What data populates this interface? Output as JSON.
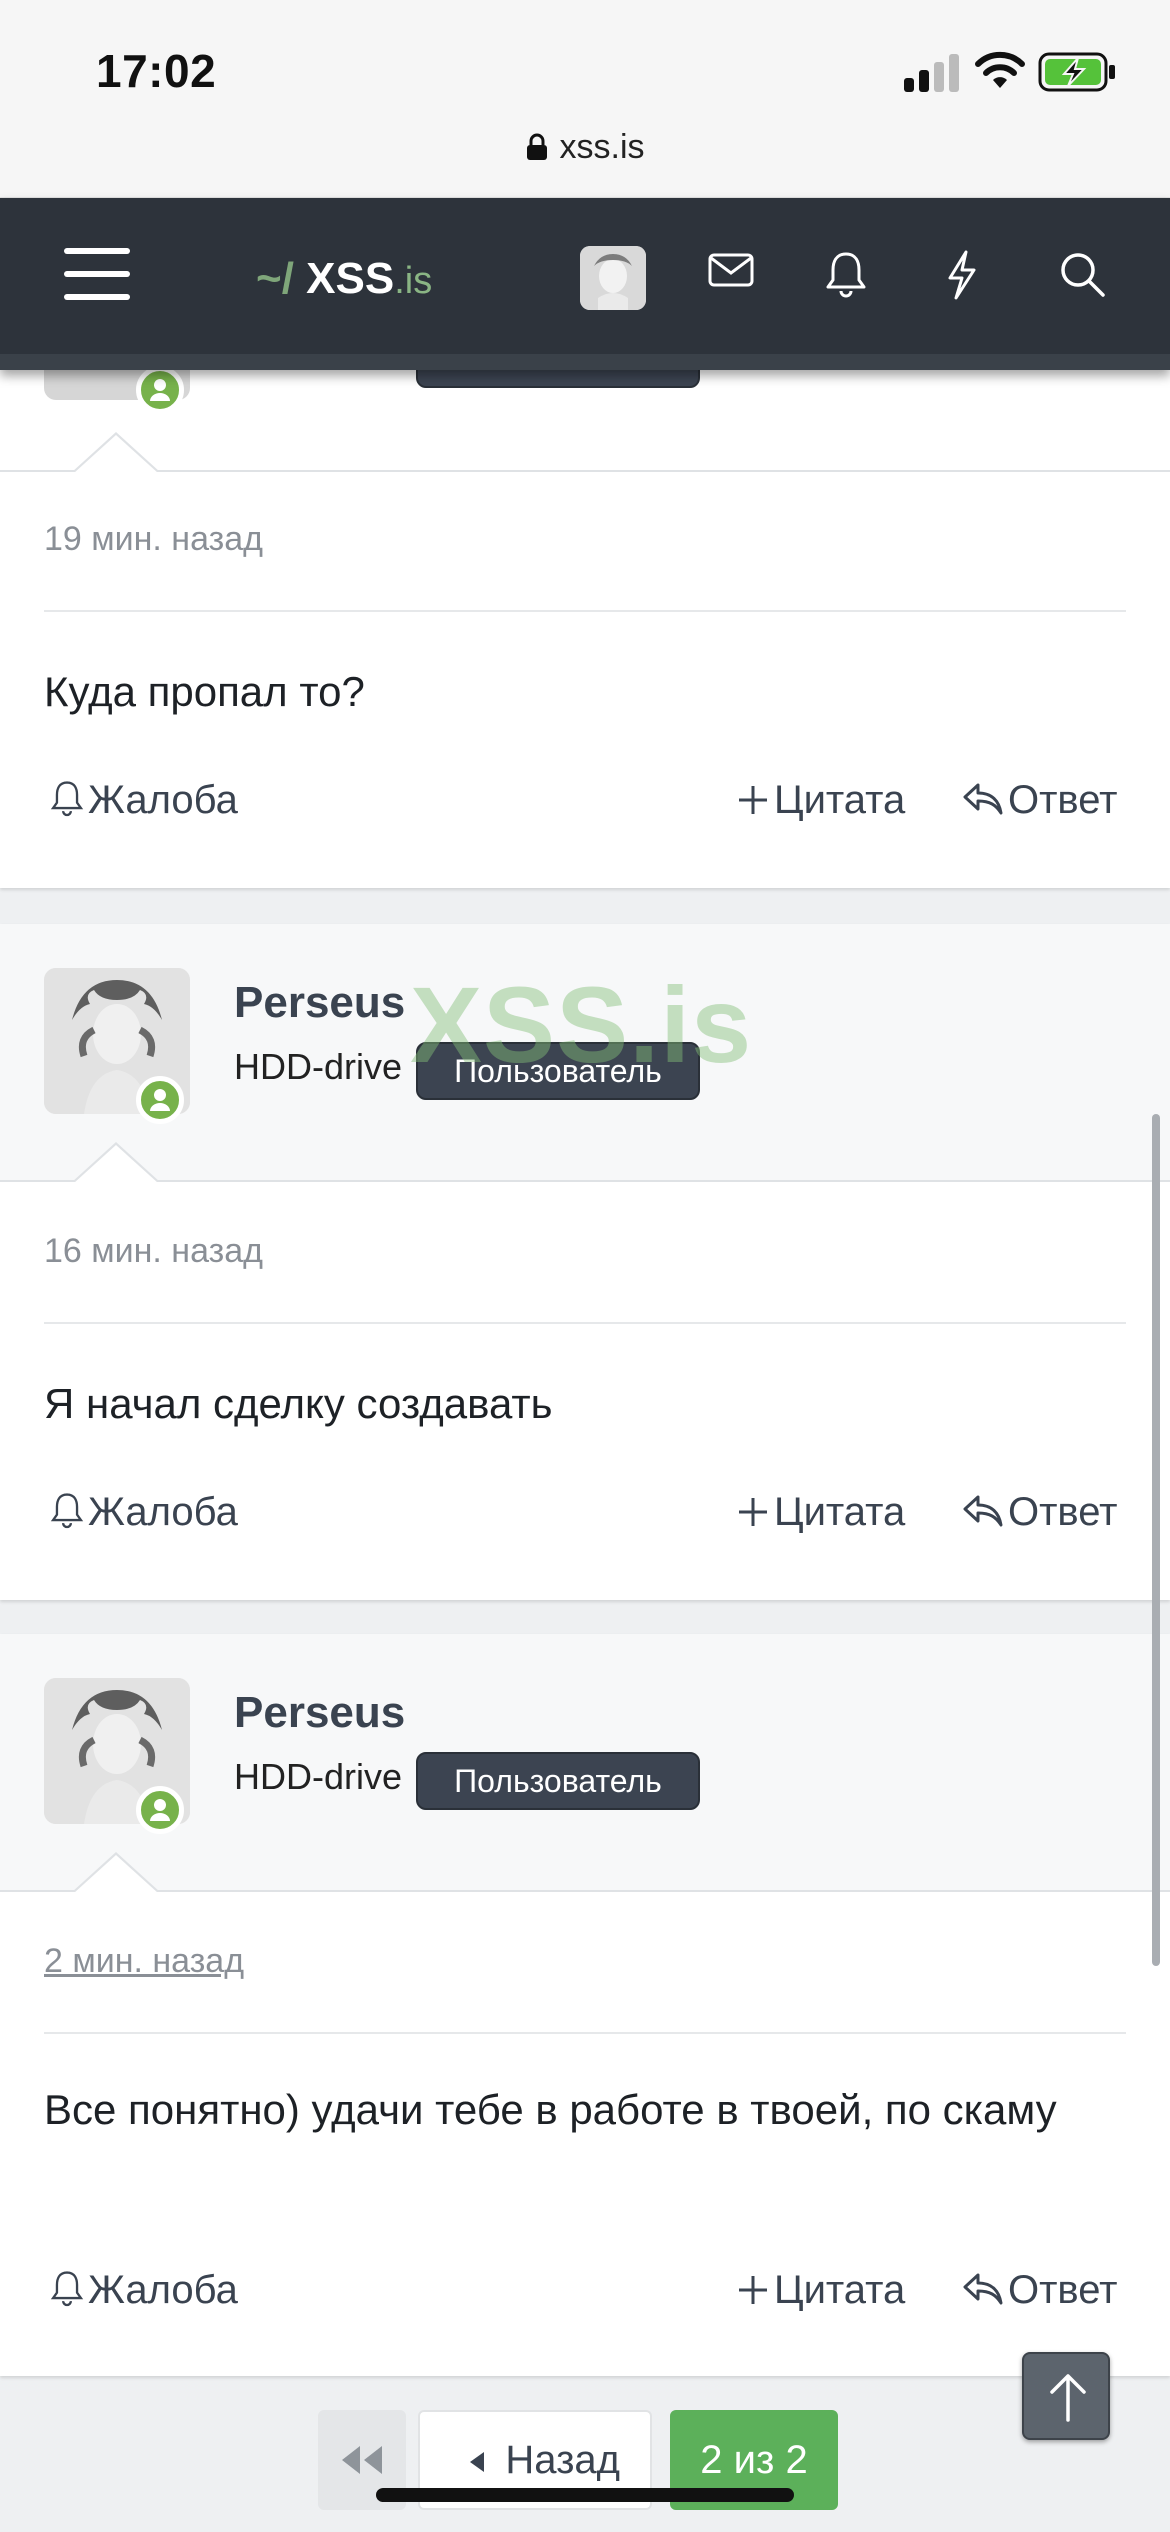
{
  "status_bar": {
    "time": "17:02",
    "url": "xss.is",
    "icons": [
      "signal-icon",
      "wifi-icon",
      "battery-charging-icon",
      "lock-icon"
    ]
  },
  "header": {
    "logo_prefix": "~/",
    "logo_main": "XSS",
    "logo_tld": ".is",
    "icons": [
      "menu-icon",
      "avatar",
      "mail-icon",
      "bell-icon",
      "lightning-icon",
      "search-icon"
    ],
    "colors": {
      "background": "#2d333b",
      "logo_accent": "#7fa67a"
    }
  },
  "watermark": "XSS.is",
  "posts": [
    {
      "time": "19 мин. назад",
      "message": "Куда пропал то?",
      "report_label": "Жалоба",
      "quote_label": "Цитата",
      "reply_label": "Ответ"
    },
    {
      "username": "Perseus",
      "user_title": "HDD-drive",
      "role": "Пользователь",
      "time": "16 мин. назад",
      "message": "Я начал сделку создавать",
      "report_label": "Жалоба",
      "quote_label": "Цитата",
      "reply_label": "Ответ"
    },
    {
      "username": "Perseus",
      "user_title": "HDD-drive",
      "role": "Пользователь",
      "time": "2 мин. назад",
      "message": "Все понятно) удачи тебе в работе в твоей, по скаму",
      "report_label": "Жалоба",
      "quote_label": "Цитата",
      "reply_label": "Ответ"
    }
  ],
  "pagination": {
    "prev_label": "Назад",
    "current_label": "2 из 2",
    "accent_color": "#5cb05a"
  }
}
